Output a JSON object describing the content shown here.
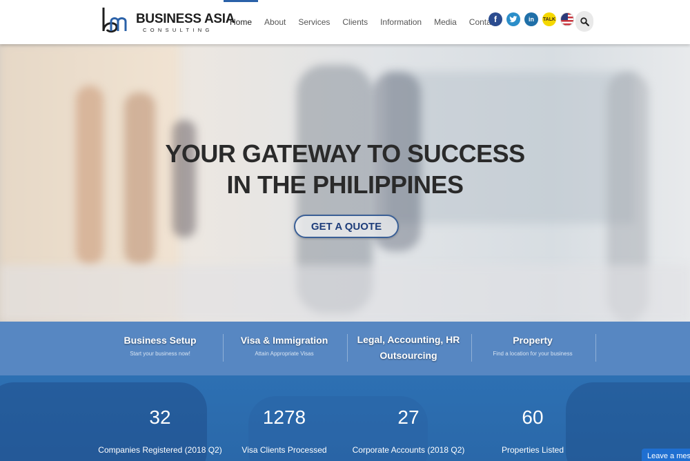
{
  "brand": {
    "name": "BUSINESS ASIA",
    "tagline": "CONSULTING"
  },
  "nav": {
    "items": [
      {
        "label": "Home",
        "active": true
      },
      {
        "label": "About"
      },
      {
        "label": "Services"
      },
      {
        "label": "Clients"
      },
      {
        "label": "Information"
      },
      {
        "label": "Media"
      },
      {
        "label": "Contact"
      }
    ]
  },
  "social": {
    "icons": [
      "facebook-icon",
      "twitter-icon",
      "linkedin-icon",
      "kakaotalk-icon",
      "us-flag-icon"
    ],
    "talk_label": "TALK",
    "accent_colors": {
      "facebook": "#2b4c8f",
      "twitter": "#2b8ec9",
      "linkedin": "#1f6fa8",
      "kakaotalk": "#f5d800"
    }
  },
  "hero": {
    "title_line1": "YOUR GATEWAY TO SUCCESS",
    "title_line2": "IN THE PHILIPPINES",
    "cta_label": "GET A QUOTE"
  },
  "services": [
    {
      "title": "Business Setup",
      "subtitle": "Start your business now!"
    },
    {
      "title": "Visa & Immigration",
      "subtitle": "Attain Appropriate Visas"
    },
    {
      "title": "Legal, Accounting, HR Outsourcing",
      "subtitle": ""
    },
    {
      "title": "Property",
      "subtitle": "Find a location for your business"
    }
  ],
  "stats": [
    {
      "value": "32",
      "label": "Companies Registered (2018 Q2)"
    },
    {
      "value": "1278",
      "label": "Visa Clients Processed"
    },
    {
      "value": "27",
      "label": "Corporate Accounts (2018 Q2)"
    },
    {
      "value": "60",
      "label": "Properties Listed"
    }
  ],
  "chat": {
    "label": "Leave a mess"
  },
  "colors": {
    "accent": "#2a61a8",
    "services_band": "#5787c2",
    "stats_band": "#2d70b3"
  }
}
